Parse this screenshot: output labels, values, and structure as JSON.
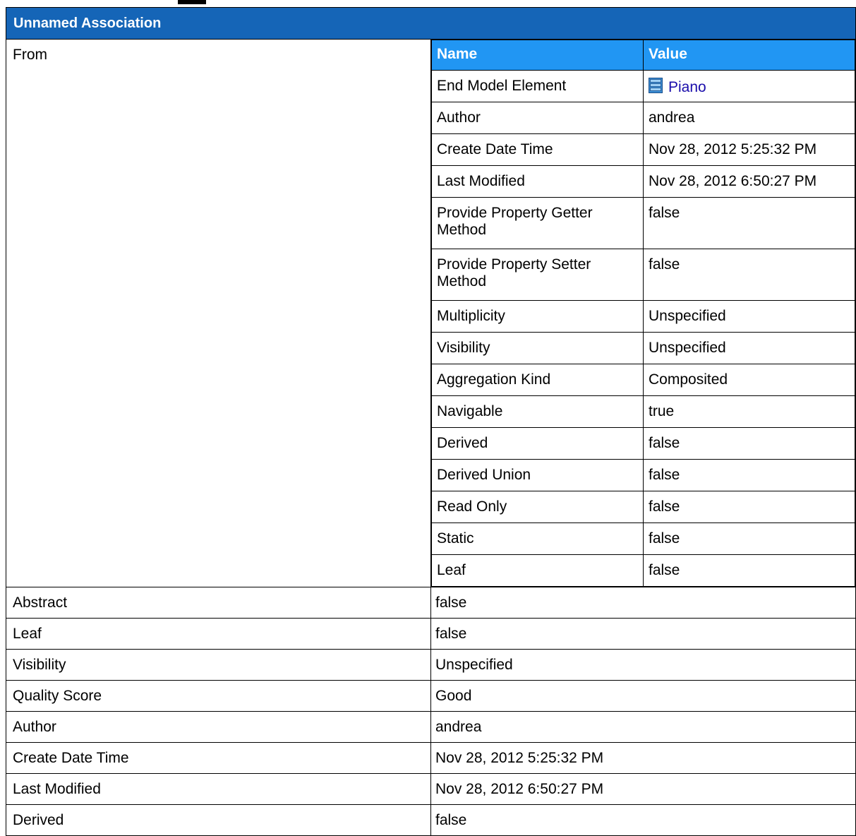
{
  "title": "Unnamed Association",
  "from": {
    "label": "From",
    "columns": {
      "name": "Name",
      "value": "Value"
    },
    "rows": [
      {
        "name": "End Model Element",
        "value": "Piano",
        "icon": "class-icon",
        "link": true
      },
      {
        "name": "Author",
        "value": "andrea"
      },
      {
        "name": "Create Date Time",
        "value": "Nov 28, 2012 5:25:32 PM"
      },
      {
        "name": "Last Modified",
        "value": "Nov 28, 2012 6:50:27 PM"
      },
      {
        "name": "Provide Property Getter Method",
        "value": "false"
      },
      {
        "name": "Provide Property Setter Method",
        "value": "false"
      },
      {
        "name": "Multiplicity",
        "value": "Unspecified"
      },
      {
        "name": "Visibility",
        "value": "Unspecified"
      },
      {
        "name": "Aggregation Kind",
        "value": "Composited"
      },
      {
        "name": "Navigable",
        "value": "true"
      },
      {
        "name": "Derived",
        "value": "false"
      },
      {
        "name": "Derived Union",
        "value": "false"
      },
      {
        "name": "Read Only",
        "value": "false"
      },
      {
        "name": "Static",
        "value": "false"
      },
      {
        "name": "Leaf",
        "value": "false"
      }
    ]
  },
  "properties": [
    {
      "name": "Abstract",
      "value": "false"
    },
    {
      "name": "Leaf",
      "value": "false"
    },
    {
      "name": "Visibility",
      "value": "Unspecified"
    },
    {
      "name": "Quality Score",
      "value": "Good"
    },
    {
      "name": "Author",
      "value": "andrea"
    },
    {
      "name": "Create Date Time",
      "value": "Nov 28, 2012 5:25:32 PM"
    },
    {
      "name": "Last Modified",
      "value": "Nov 28, 2012 6:50:27 PM"
    },
    {
      "name": "Derived",
      "value": "false"
    }
  ],
  "colors": {
    "title_bg": "#1565b7",
    "header_bg": "#2196f3",
    "link": "#1a0dab"
  }
}
